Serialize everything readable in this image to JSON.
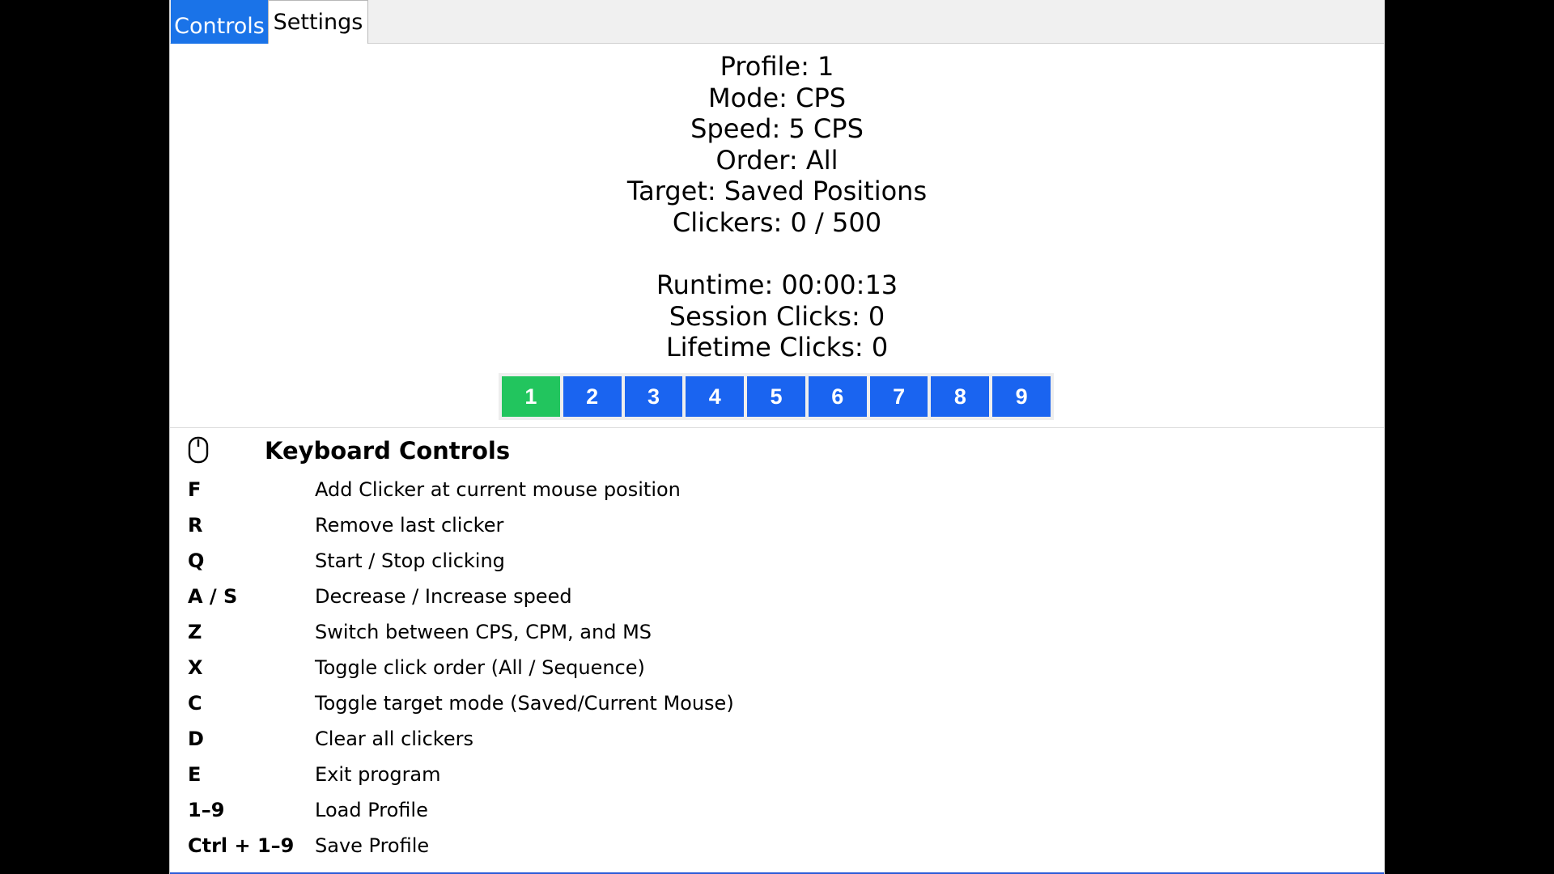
{
  "tabs": [
    {
      "label": "Controls",
      "active": true
    },
    {
      "label": "Settings",
      "active": false
    }
  ],
  "status": {
    "profile": "Profile: 1",
    "mode": "Mode: CPS",
    "speed": "Speed: 5 CPS",
    "order": "Order: All",
    "target": "Target: Saved Positions",
    "clickers": "Clickers: 0 / 500",
    "runtime": "Runtime: 00:00:13",
    "session_clicks": "Session Clicks: 0",
    "lifetime_clicks": "Lifetime Clicks: 0"
  },
  "profiles": {
    "active": "1",
    "buttons": [
      "1",
      "2",
      "3",
      "4",
      "5",
      "6",
      "7",
      "8",
      "9"
    ]
  },
  "keyboard_controls": {
    "icon": "mouse-icon",
    "title": "Keyboard Controls",
    "rows": [
      {
        "key": "F",
        "desc": "Add Clicker at current mouse position"
      },
      {
        "key": "R",
        "desc": "Remove last clicker"
      },
      {
        "key": "Q",
        "desc": "Start / Stop clicking"
      },
      {
        "key": "A / S",
        "desc": "Decrease / Increase speed"
      },
      {
        "key": "Z",
        "desc": "Switch between CPS, CPM, and MS"
      },
      {
        "key": "X",
        "desc": "Toggle click order (All / Sequence)"
      },
      {
        "key": "C",
        "desc": "Toggle target mode (Saved/Current Mouse)"
      },
      {
        "key": "D",
        "desc": "Clear all clickers"
      },
      {
        "key": "E",
        "desc": "Exit program"
      },
      {
        "key": "1–9",
        "desc": "Load Profile"
      },
      {
        "key": "Ctrl + 1–9",
        "desc": "Save Profile"
      }
    ]
  },
  "colors": {
    "active_tab": "#1a73e8",
    "profile_button": "#1a64f0",
    "active_profile": "#22c55e",
    "background": "#000000",
    "window": "#ffffff"
  }
}
